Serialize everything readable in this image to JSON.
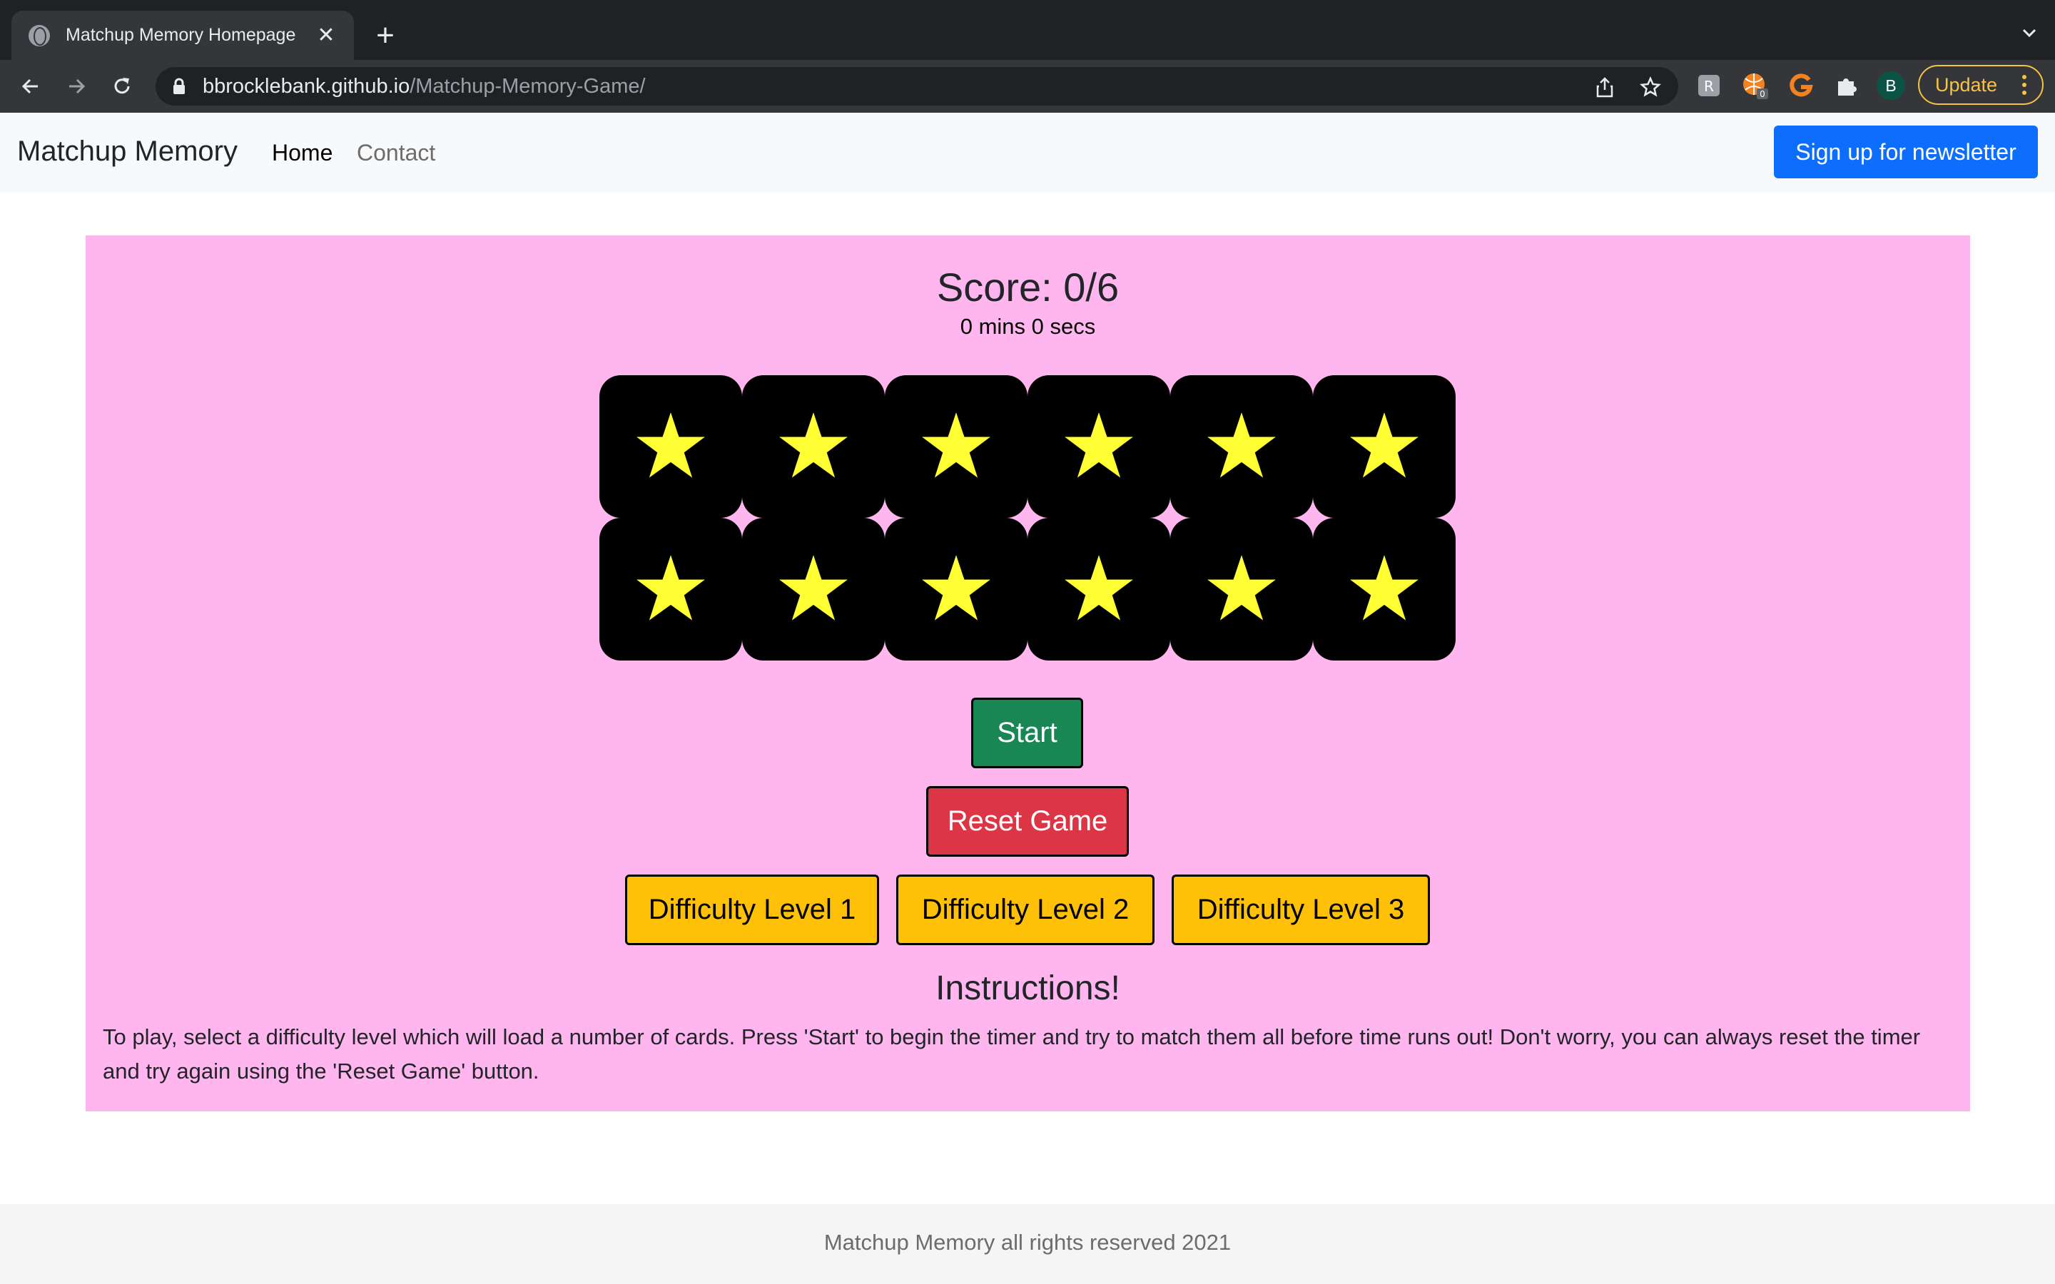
{
  "browser": {
    "tab_title": "Matchup Memory Homepage",
    "tab_close_label": "✕",
    "new_tab_label": "+",
    "url_host": "bbrocklebank.github.io",
    "url_path": "/Matchup-Memory-Game/",
    "profile_initial": "B",
    "extension_badge": "0",
    "update_label": "Update"
  },
  "navbar": {
    "brand": "Matchup Memory",
    "links": [
      {
        "label": "Home",
        "active": true
      },
      {
        "label": "Contact",
        "active": false
      }
    ],
    "newsletter_label": "Sign up for newsletter"
  },
  "game": {
    "score_text": "Score: 0/6",
    "timer_text": "0 mins 0 secs",
    "card_rows": 2,
    "card_columns": 6,
    "card_face": "star-icon",
    "card_back_color": "#000000",
    "star_color": "#ffff33",
    "start_label": "Start",
    "reset_label": "Reset Game",
    "difficulty_levels": [
      "Difficulty Level 1",
      "Difficulty Level 2",
      "Difficulty Level 3"
    ]
  },
  "instructions": {
    "title": "Instructions!",
    "text": "To play, select a difficulty level which will load a number of cards. Press 'Start' to begin the timer and try to match them all before time runs out! Don't worry, you can always reset the timer and try again using the 'Reset Game' button."
  },
  "footer": {
    "text": "Matchup Memory all rights reserved 2021"
  },
  "colors": {
    "game_background": "#ffb6ee",
    "start": "#198754",
    "reset": "#dc3545",
    "difficulty": "#ffc107",
    "newsletter": "#0d6efd"
  }
}
